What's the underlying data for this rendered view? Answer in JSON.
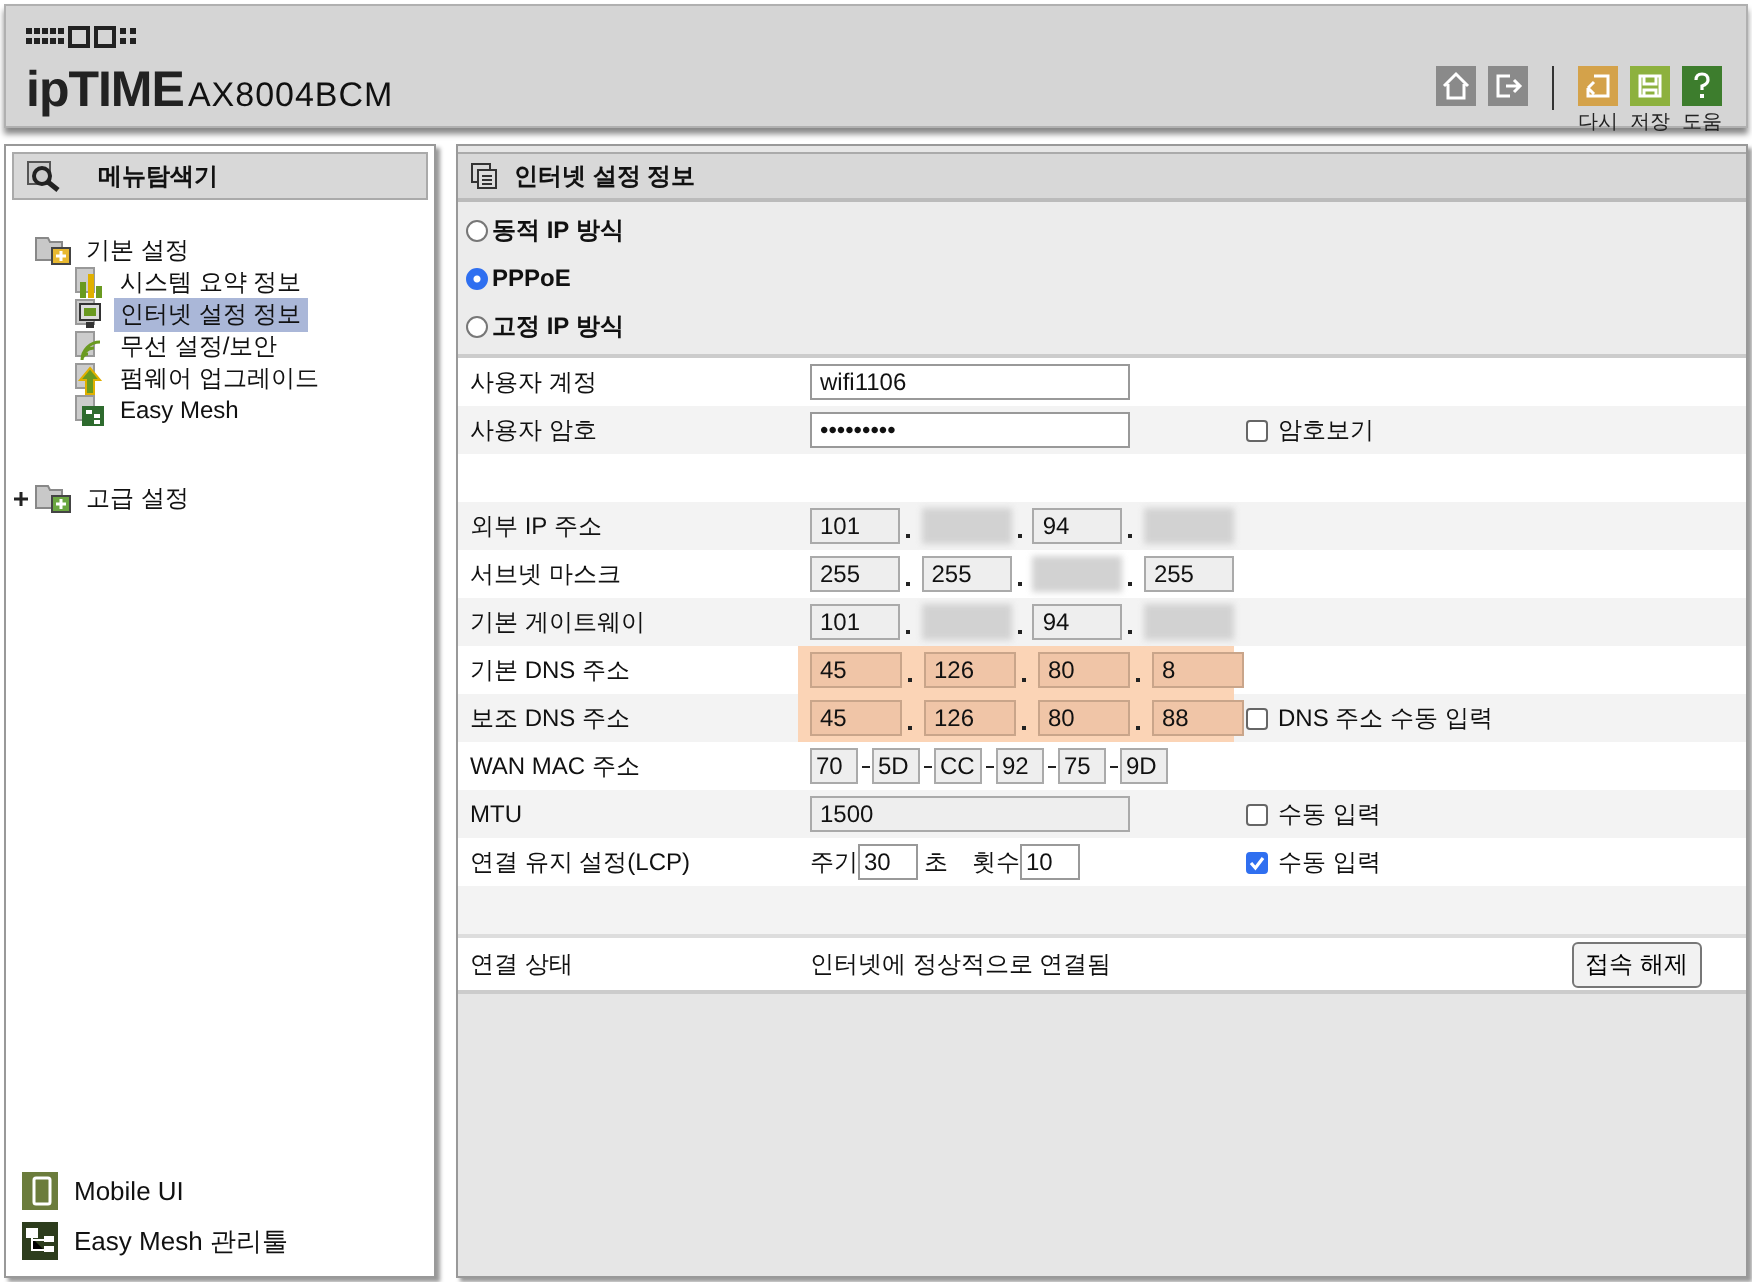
{
  "header": {
    "logo": "ipTIME",
    "model": "AX8004BCM",
    "tools": [
      {
        "kind": "home"
      },
      {
        "kind": "logout"
      },
      {
        "kind": "reset",
        "label": "다시"
      },
      {
        "kind": "save",
        "label": "저장"
      },
      {
        "kind": "help",
        "label": "도움"
      }
    ]
  },
  "sidebar": {
    "title": "메뉴탐색기",
    "tree": [
      {
        "label": "기본 설정",
        "expanded": true,
        "children": [
          {
            "label": "시스템 요약 정보",
            "kind": "chart",
            "selected": false
          },
          {
            "label": "인터넷 설정 정보",
            "kind": "monitor",
            "selected": true
          },
          {
            "label": "무선 설정/보안",
            "kind": "wifi",
            "selected": false
          },
          {
            "label": "펌웨어 업그레이드",
            "kind": "upgrade",
            "selected": false
          },
          {
            "label": "Easy Mesh",
            "kind": "mesh",
            "selected": false
          }
        ]
      },
      {
        "label": "고급 설정",
        "expanded": false
      }
    ],
    "links": [
      {
        "label": "Mobile UI",
        "kind": "mobile"
      },
      {
        "label": "Easy Mesh 관리툴",
        "kind": "mesh"
      }
    ]
  },
  "panel": {
    "title": "인터넷 설정 정보",
    "modes": [
      {
        "label": "동적 IP 방식",
        "selected": false
      },
      {
        "label": "PPPoE",
        "selected": true
      },
      {
        "label": "고정 IP 방식",
        "selected": false
      }
    ],
    "rows": [
      {
        "kind": "text",
        "label": "사용자 계정",
        "value": "wifi1106",
        "disabled": false
      },
      {
        "kind": "text",
        "label": "사용자 암호",
        "value": "•••••••••",
        "disabled": false,
        "option": {
          "label": "암호보기",
          "checked": false
        }
      },
      {
        "kind": "spacer"
      },
      {
        "kind": "ip",
        "label": "외부 IP 주소",
        "highlighted": false,
        "octets": [
          {
            "value": "101",
            "blurred": false
          },
          {
            "blurred": true
          },
          {
            "value": "94",
            "blurred": false
          },
          {
            "blurred": true
          }
        ]
      },
      {
        "kind": "ip",
        "label": "서브넷 마스크",
        "highlighted": false,
        "octets": [
          {
            "value": "255",
            "blurred": false
          },
          {
            "value": "255",
            "blurred": false
          },
          {
            "blurred": true
          },
          {
            "value": "255",
            "blurred": false
          }
        ]
      },
      {
        "kind": "ip",
        "label": "기본 게이트웨이",
        "highlighted": false,
        "octets": [
          {
            "value": "101",
            "blurred": false
          },
          {
            "blurred": true
          },
          {
            "value": "94",
            "blurred": false
          },
          {
            "blurred": true
          }
        ]
      },
      {
        "kind": "ip",
        "label": "기본 DNS 주소",
        "highlighted": true,
        "octets": [
          {
            "value": "45",
            "blurred": false
          },
          {
            "value": "126",
            "blurred": false
          },
          {
            "value": "80",
            "blurred": false
          },
          {
            "value": "8",
            "blurred": false
          }
        ]
      },
      {
        "kind": "ip",
        "label": "보조 DNS 주소",
        "highlighted": true,
        "octets": [
          {
            "value": "45",
            "blurred": false
          },
          {
            "value": "126",
            "blurred": false
          },
          {
            "value": "80",
            "blurred": false
          },
          {
            "value": "88",
            "blurred": false
          }
        ],
        "option": {
          "label": "DNS 주소 수동 입력",
          "checked": false
        }
      },
      {
        "kind": "mac",
        "label": "WAN MAC 주소",
        "parts": [
          "70",
          "5D",
          "CC",
          "92",
          "75",
          "9D"
        ]
      },
      {
        "kind": "text",
        "label": "MTU",
        "value": "1500",
        "disabled": true,
        "option": {
          "label": "수동 입력",
          "checked": false
        }
      },
      {
        "kind": "lcp",
        "label": "연결 유지 설정(LCP)",
        "period_label": "주기",
        "period": "30",
        "unit": "초",
        "count_label": "횟수",
        "count": "10",
        "option": {
          "label": "수동 입력",
          "checked": true
        }
      },
      {
        "kind": "spacer"
      }
    ],
    "status": {
      "label": "연결 상태",
      "value": "인터넷에 정상적으로 연결됨",
      "button": "접속 해제"
    }
  }
}
